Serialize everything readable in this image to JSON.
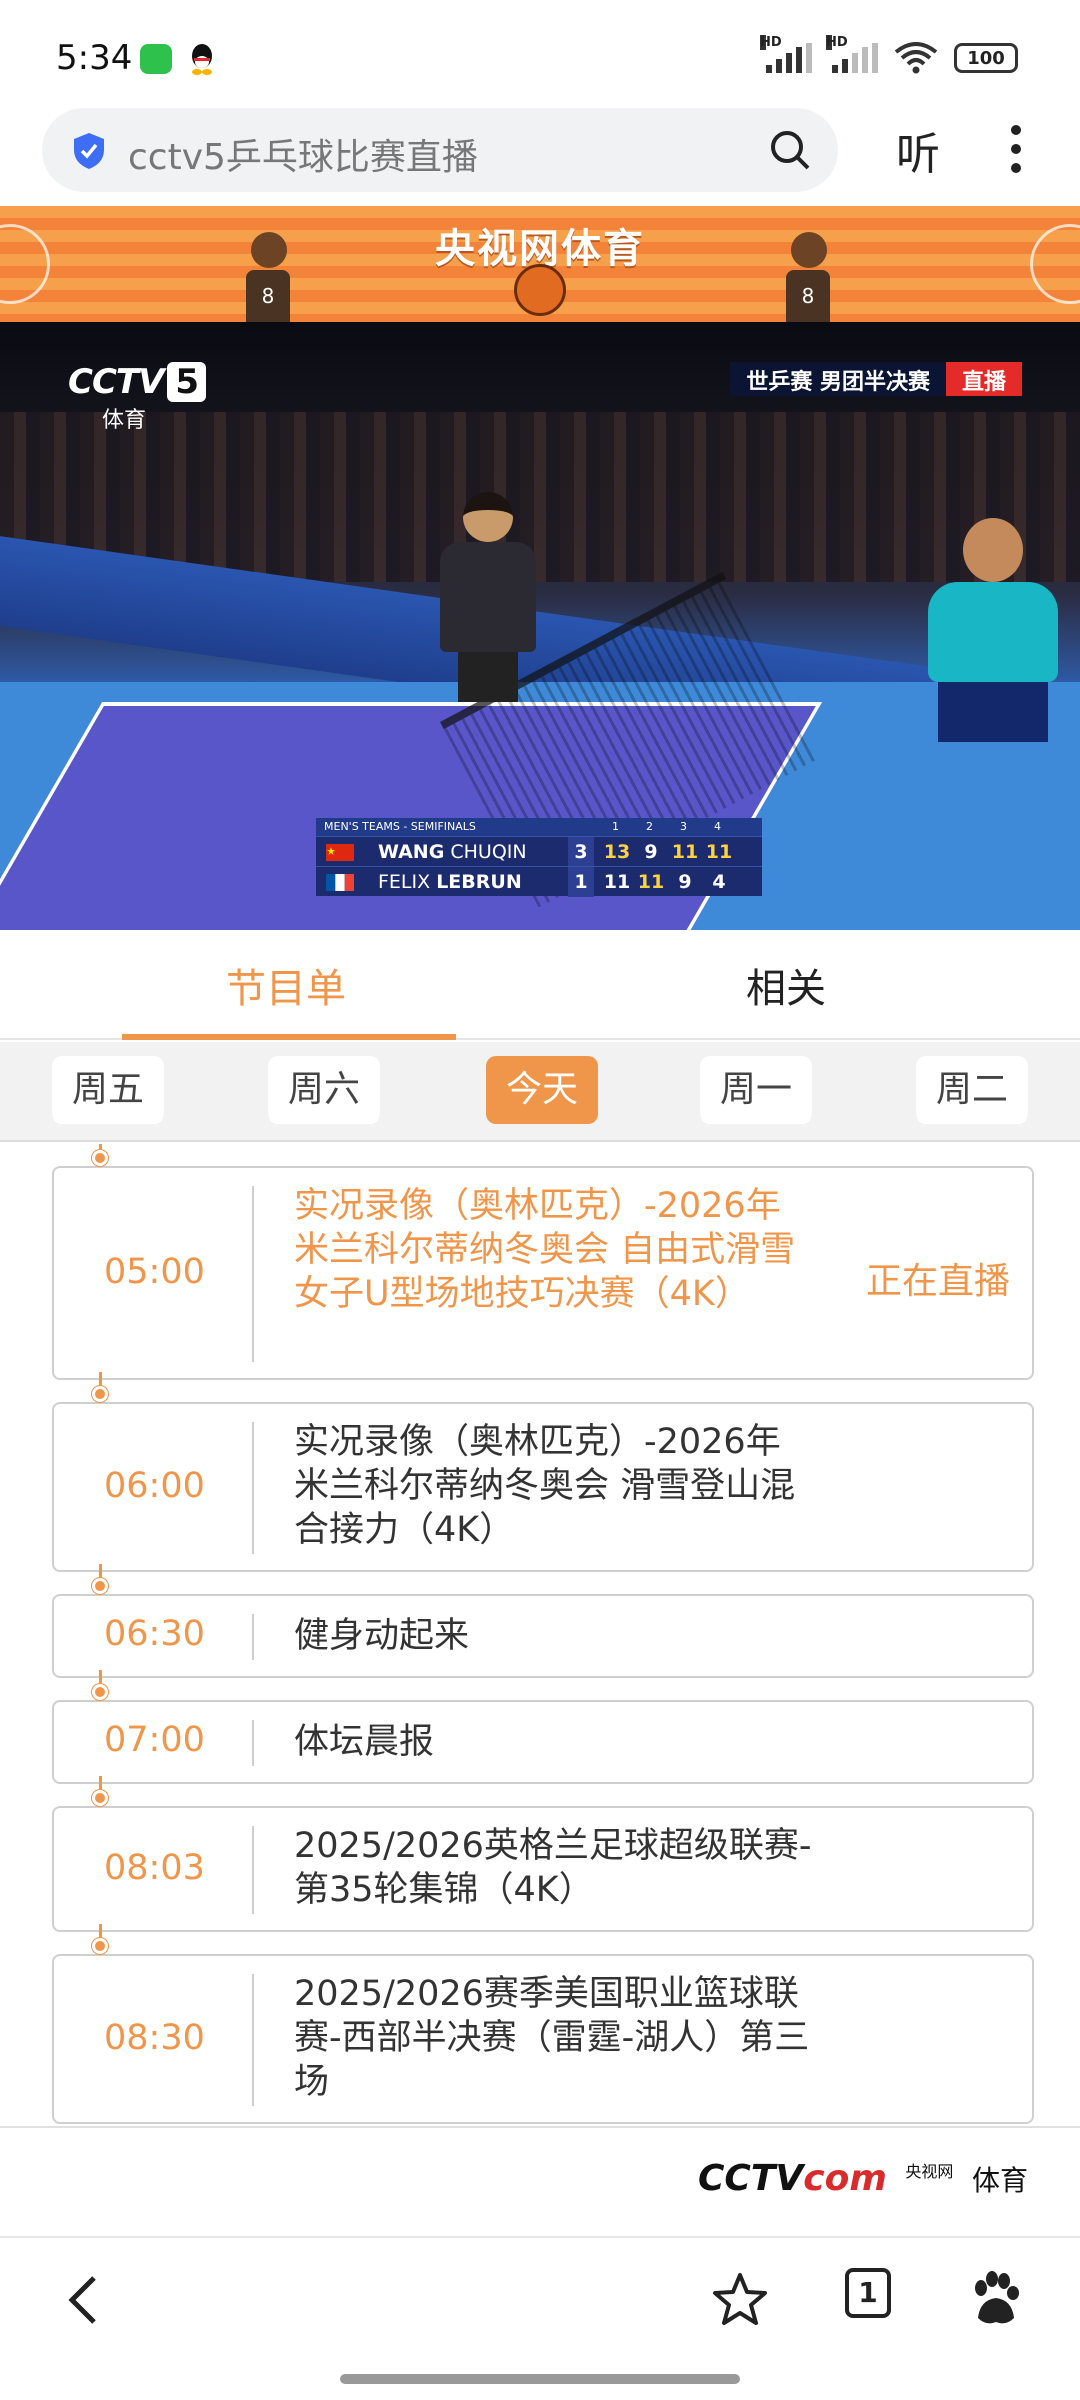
{
  "status_bar": {
    "time": "5:34",
    "signal1_label": "HD",
    "signal2_label": "HD",
    "battery": "100",
    "icons": [
      "wechat-icon",
      "qq-icon",
      "signal-icon",
      "wifi-icon",
      "battery-icon"
    ]
  },
  "browser": {
    "search_query": "cctv5乒乓球比赛直播",
    "listen_label": "听",
    "tab_count": "1",
    "icons": [
      "shield-icon",
      "search-icon",
      "more-icon",
      "back-icon",
      "star-icon",
      "baidu-paw-icon"
    ]
  },
  "banner": {
    "title": "央视网体育",
    "mascot_left_number": "8",
    "mascot_right_number": "8"
  },
  "video": {
    "channel_logo": "CCTV",
    "channel_number": "5",
    "channel_sub": "体育",
    "tag_text": "世乒赛  男团半决赛",
    "tag_live": "直播",
    "scoreboard": {
      "header": "MEN'S TEAMS - SEMIFINALS",
      "game_numbers": [
        "1",
        "2",
        "3",
        "4"
      ],
      "rows": [
        {
          "first": "WANG",
          "last": "CHUQIN",
          "sets": "3",
          "games": [
            "13",
            "9",
            "11",
            "11"
          ]
        },
        {
          "first": "FELIX",
          "last": "LEBRUN",
          "sets": "1",
          "games": [
            "11",
            "11",
            "9",
            "4"
          ]
        }
      ]
    }
  },
  "tabs": {
    "schedule": "节目单",
    "related": "相关"
  },
  "days": [
    "周五",
    "周六",
    "今天",
    "周一",
    "周二"
  ],
  "schedule": [
    {
      "time": "05:00",
      "title": "实况录像（奥林匹克）-2026年米兰科尔蒂纳冬奥会 自由式滑雪女子U型场地技巧决赛（4K）",
      "live": "正在直播"
    },
    {
      "time": "06:00",
      "title": "实况录像（奥林匹克）-2026年米兰科尔蒂纳冬奥会 滑雪登山混合接力（4K）"
    },
    {
      "time": "06:30",
      "title": "健身动起来"
    },
    {
      "time": "07:00",
      "title": "体坛晨报"
    },
    {
      "time": "08:03",
      "title": "2025/2026英格兰足球超级联赛-第35轮集锦（4K）"
    },
    {
      "time": "08:30",
      "title": "2025/2026赛季美国职业篮球联赛-西部半决赛（雷霆-湖人）第三场"
    }
  ],
  "footer": {
    "logo_main": "CCTV",
    "logo_domain": "com",
    "logo_small": "央视网",
    "logo_sub": "体育"
  }
}
